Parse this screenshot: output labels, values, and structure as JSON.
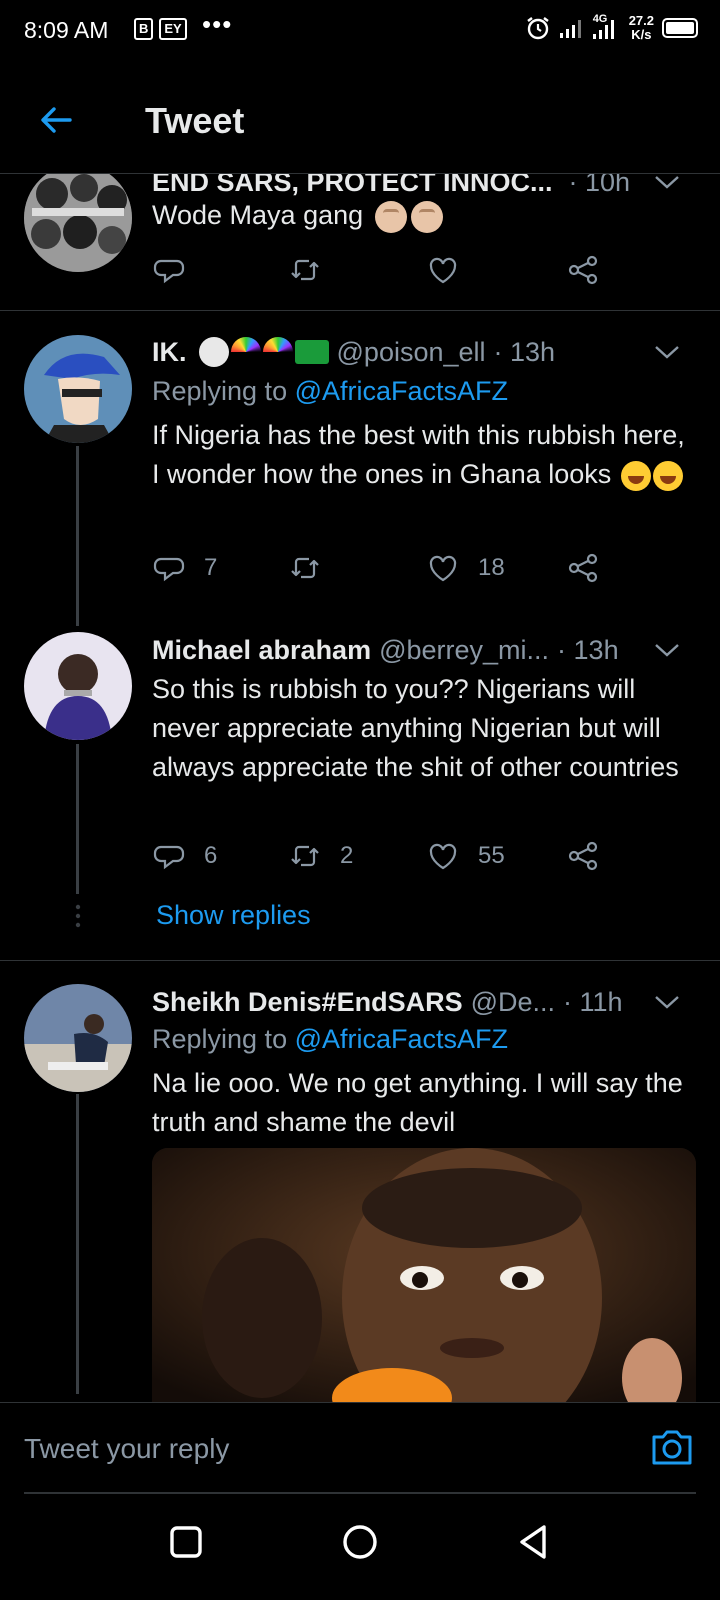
{
  "status_bar": {
    "time": "8:09 AM",
    "notif_icon_1": "B",
    "notif_icon_2": "EY",
    "more_dots": "•••",
    "network": "4G",
    "speed_value": "27.2",
    "speed_unit": "K/s"
  },
  "header": {
    "title": "Tweet"
  },
  "tweets": [
    {
      "name": "END SARS, PROTECT INNOC...",
      "handle": "",
      "time": "· 10h",
      "text": "Wode Maya gang",
      "reply_count": "",
      "retweet_count": "",
      "like_count": ""
    },
    {
      "name": "IK.",
      "handle": "@poison_ell",
      "time": "· 13h",
      "replying_prefix": "Replying to",
      "replying_to": "@AfricaFactsAFZ",
      "text": "If Nigeria has the best with this rubbish here, I wonder how the ones in Ghana looks",
      "reply_count": "7",
      "retweet_count": "",
      "like_count": "18"
    },
    {
      "name": "Michael abraham",
      "handle": "@berrey_mi...",
      "time": "· 13h",
      "text": "So this is rubbish to you?? Nigerians will never appreciate anything Nigerian but will always appreciate the shit of other countries",
      "reply_count": "6",
      "retweet_count": "2",
      "like_count": "55",
      "show_replies": "Show replies"
    },
    {
      "name": "Sheikh Denis#EndSARS",
      "handle": "@De...",
      "time": "· 11h",
      "replying_prefix": "Replying to",
      "replying_to": "@AfricaFactsAFZ",
      "text": "Na lie ooo. We no get anything. I will say the truth and shame the devil"
    }
  ],
  "reply_bar": {
    "placeholder": "Tweet your reply"
  },
  "colors": {
    "background": "#000000",
    "accent": "#1d9bf0",
    "secondary_text": "#8b98a5",
    "divider": "#2f3336"
  },
  "icons": [
    "back-arrow-icon",
    "reply-icon",
    "retweet-icon",
    "like-icon",
    "share-icon",
    "camera-icon",
    "chevron-down-icon",
    "home-nav-icon",
    "back-nav-icon",
    "recents-nav-icon"
  ]
}
